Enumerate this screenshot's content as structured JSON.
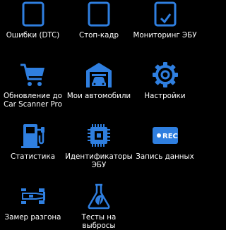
{
  "menu": {
    "items": [
      {
        "label_lines": [
          "Ошибки (DTC)"
        ],
        "icon": "error-codes-icon"
      },
      {
        "label_lines": [
          "Стоп-кадр"
        ],
        "icon": "freeze-frame-icon"
      },
      {
        "label_lines": [
          "Мониторинг ЭБУ"
        ],
        "icon": "ecu-monitoring-icon"
      },
      {
        "label_lines": [
          "Обновление до",
          "Car Scanner Pro"
        ],
        "icon": "shopping-cart-icon"
      },
      {
        "label_lines": [
          "Мои автомобили"
        ],
        "icon": "garage-car-icon"
      },
      {
        "label_lines": [
          "Настройки"
        ],
        "icon": "gear-icon"
      },
      {
        "label_lines": [
          "Статистика"
        ],
        "icon": "fuel-pump-icon"
      },
      {
        "label_lines": [
          "Идентификаторы",
          "ЭБУ"
        ],
        "icon": "chip-icon"
      },
      {
        "label_lines": [
          "Запись данных"
        ],
        "icon": "rec-icon"
      },
      {
        "label_lines": [
          "Замер разгона"
        ],
        "icon": "race-car-icon"
      },
      {
        "label_lines": [
          "Тесты на",
          "выбросы"
        ],
        "icon": "flask-leaf-icon"
      }
    ]
  },
  "colors": {
    "accent": "#2f7fe0",
    "background": "#000000",
    "text": "#ffffff"
  },
  "rec_icon_text": "REC"
}
